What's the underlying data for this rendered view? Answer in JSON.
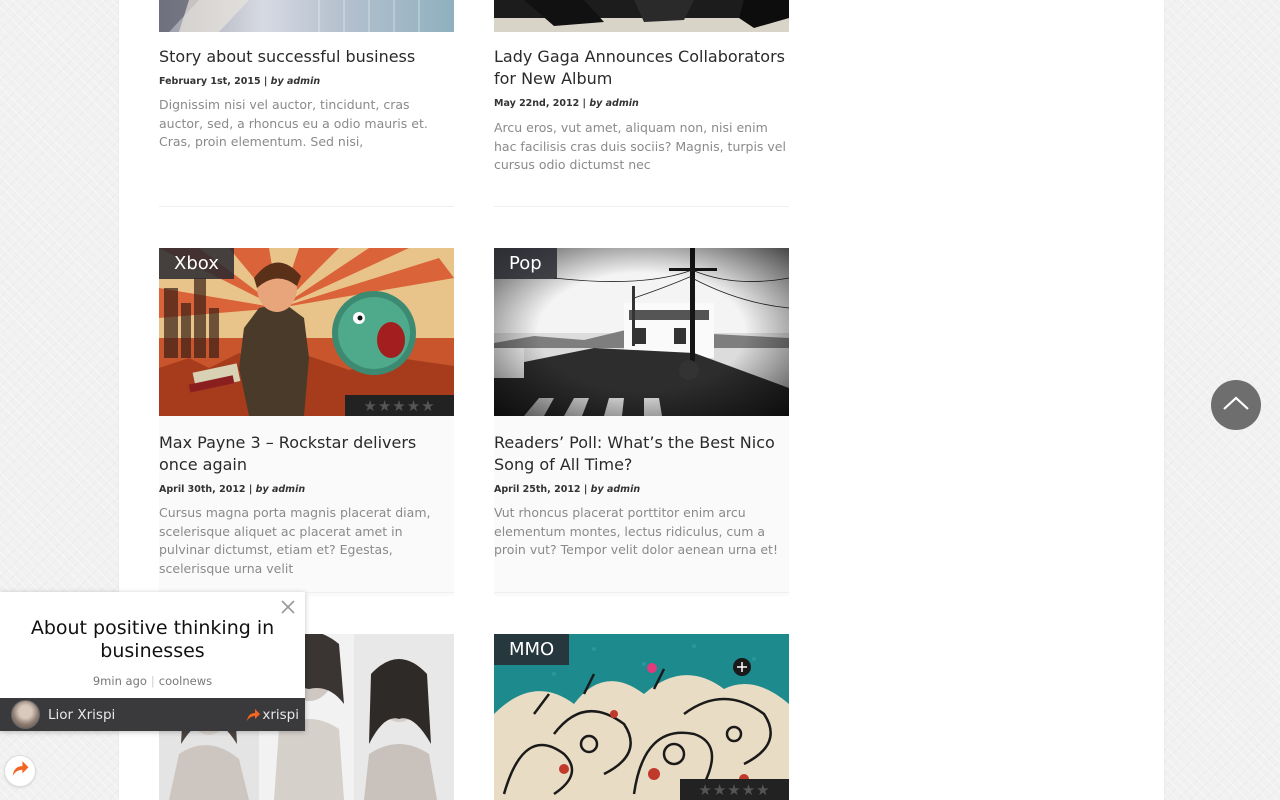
{
  "posts": [
    {
      "title": "Story about successful business",
      "date": "February 1st, 2015",
      "by": "by admin",
      "excerpt": "Dignissim nisi vel auctor, tincidunt, cras auctor, sed, a rhoncus eu a odio mauris et. Cras, proin elementum. Sed nisi,"
    },
    {
      "title": "Lady Gaga Announces Collaborators for New Album",
      "date": "May 22nd, 2012",
      "by": "by admin",
      "excerpt": "Arcu eros, vut amet, aliquam non, nisi enim hac facilisis cras duis sociis? Magnis, turpis vel cursus odio dictumst nec"
    },
    {
      "category": "Xbox",
      "title": "Max Payne 3 – Rockstar delivers once again",
      "date": "April 30th, 2012",
      "by": "by admin",
      "excerpt": "Cursus magna porta magnis placerat diam, scelerisque aliquet ac placerat amet in pulvinar dictumst, etiam et? Egestas, scelerisque urna velit"
    },
    {
      "category": "Pop",
      "title": "Readers’ Poll: What’s the Best Nico Song of All Time?",
      "date": "April 25th, 2012",
      "by": "by admin",
      "excerpt": "Vut rhoncus placerat porttitor enim arcu elementum montes, lectus ridiculus, cum a proin vut? Tempor velit dolor aenean urna et!"
    },
    {
      "category": "MMO"
    }
  ],
  "date_separator": "|",
  "rating_stars": "★★★★★",
  "popup": {
    "title": "About positive thinking in businesses",
    "time": "9min ago",
    "source": "coolnews",
    "meta_separator": "|",
    "author": "Lior Xrispi",
    "handle": "xrispi"
  },
  "icons": {
    "close": "close-icon",
    "scroll_top": "chevron-up-icon",
    "share": "share-arrow-icon"
  },
  "colors": {
    "badge_bg": "#2e2e36",
    "scroll_top_bg": "#6e6e6e",
    "share_accent": "#f26522"
  }
}
